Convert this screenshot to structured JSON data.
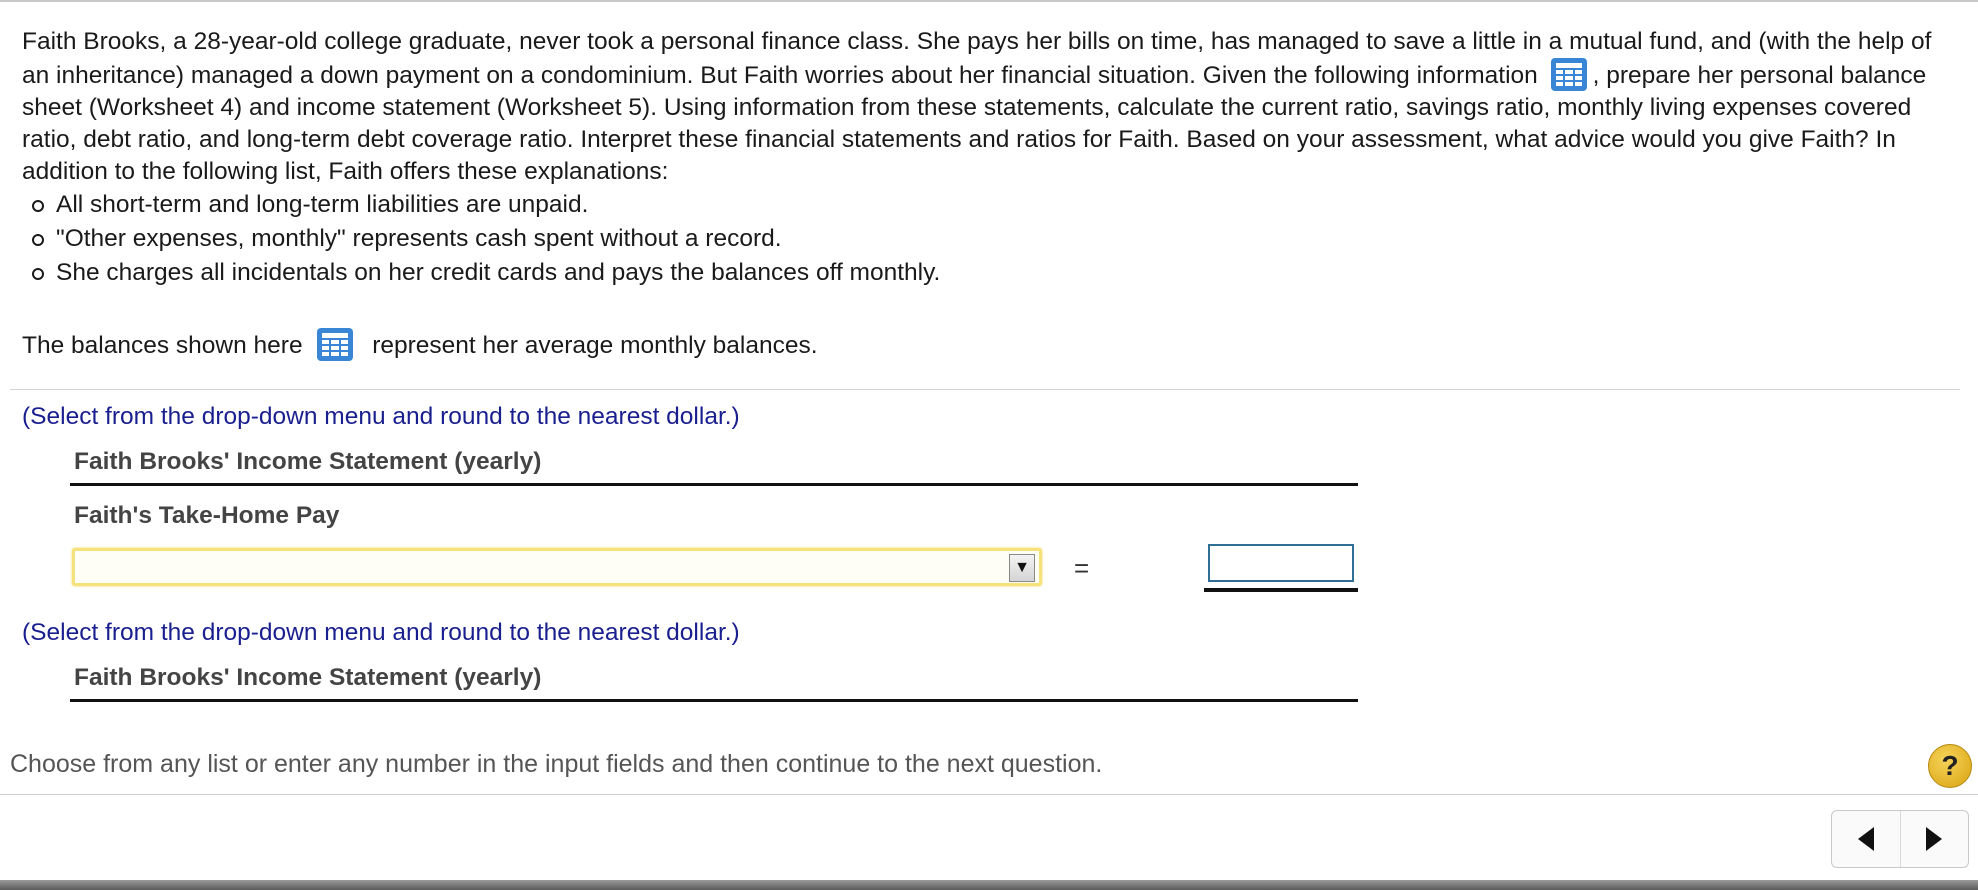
{
  "question": {
    "intro_part1": "Faith Brooks, a 28-year-old college graduate, never took a personal finance class. She pays her bills on time, has managed to save a little in a mutual fund, and (with the help of an inheritance) managed a down payment on a condominium. But Faith worries about her financial situation. Given the following information",
    "intro_part2": ", prepare her personal balance sheet (Worksheet 4) and income statement (Worksheet 5).  Using information from these statements, calculate the current ratio, savings ratio, monthly living expenses covered ratio, debt ratio, and long-term debt coverage ratio. Interpret these financial statements and ratios for Faith. Based on your assessment, what advice would you give Faith?  In addition to the following list, Faith offers these explanations:",
    "bullets": [
      "All short-term and long-term liabilities are unpaid.",
      "\"Other expenses, monthly\" represents cash spent without a record.",
      "She charges all incidentals on her credit cards and pays the balances off monthly."
    ],
    "balances_before": "The balances shown here",
    "balances_after": "represent her average monthly balances."
  },
  "instruction": "(Select from the drop-down menu and round to the nearest dollar.)",
  "income_statement_title": "Faith Brooks' Income Statement (yearly)",
  "take_home_label": "Faith's Take-Home Pay",
  "select_value": "",
  "equals": "=",
  "amount_value": "",
  "footer": "Choose from any list or enter any number in the input fields and then continue to the next question.",
  "help_label": "?",
  "icons": {
    "table": "table-grid-icon",
    "help": "help-icon",
    "prev": "arrow-left-icon",
    "next": "arrow-right-icon"
  },
  "colors": {
    "instruction_text": "#1a1f8f",
    "table_icon": "#3a86d6",
    "select_highlight": "#f5e27a",
    "help_button": "#e6b82a"
  }
}
